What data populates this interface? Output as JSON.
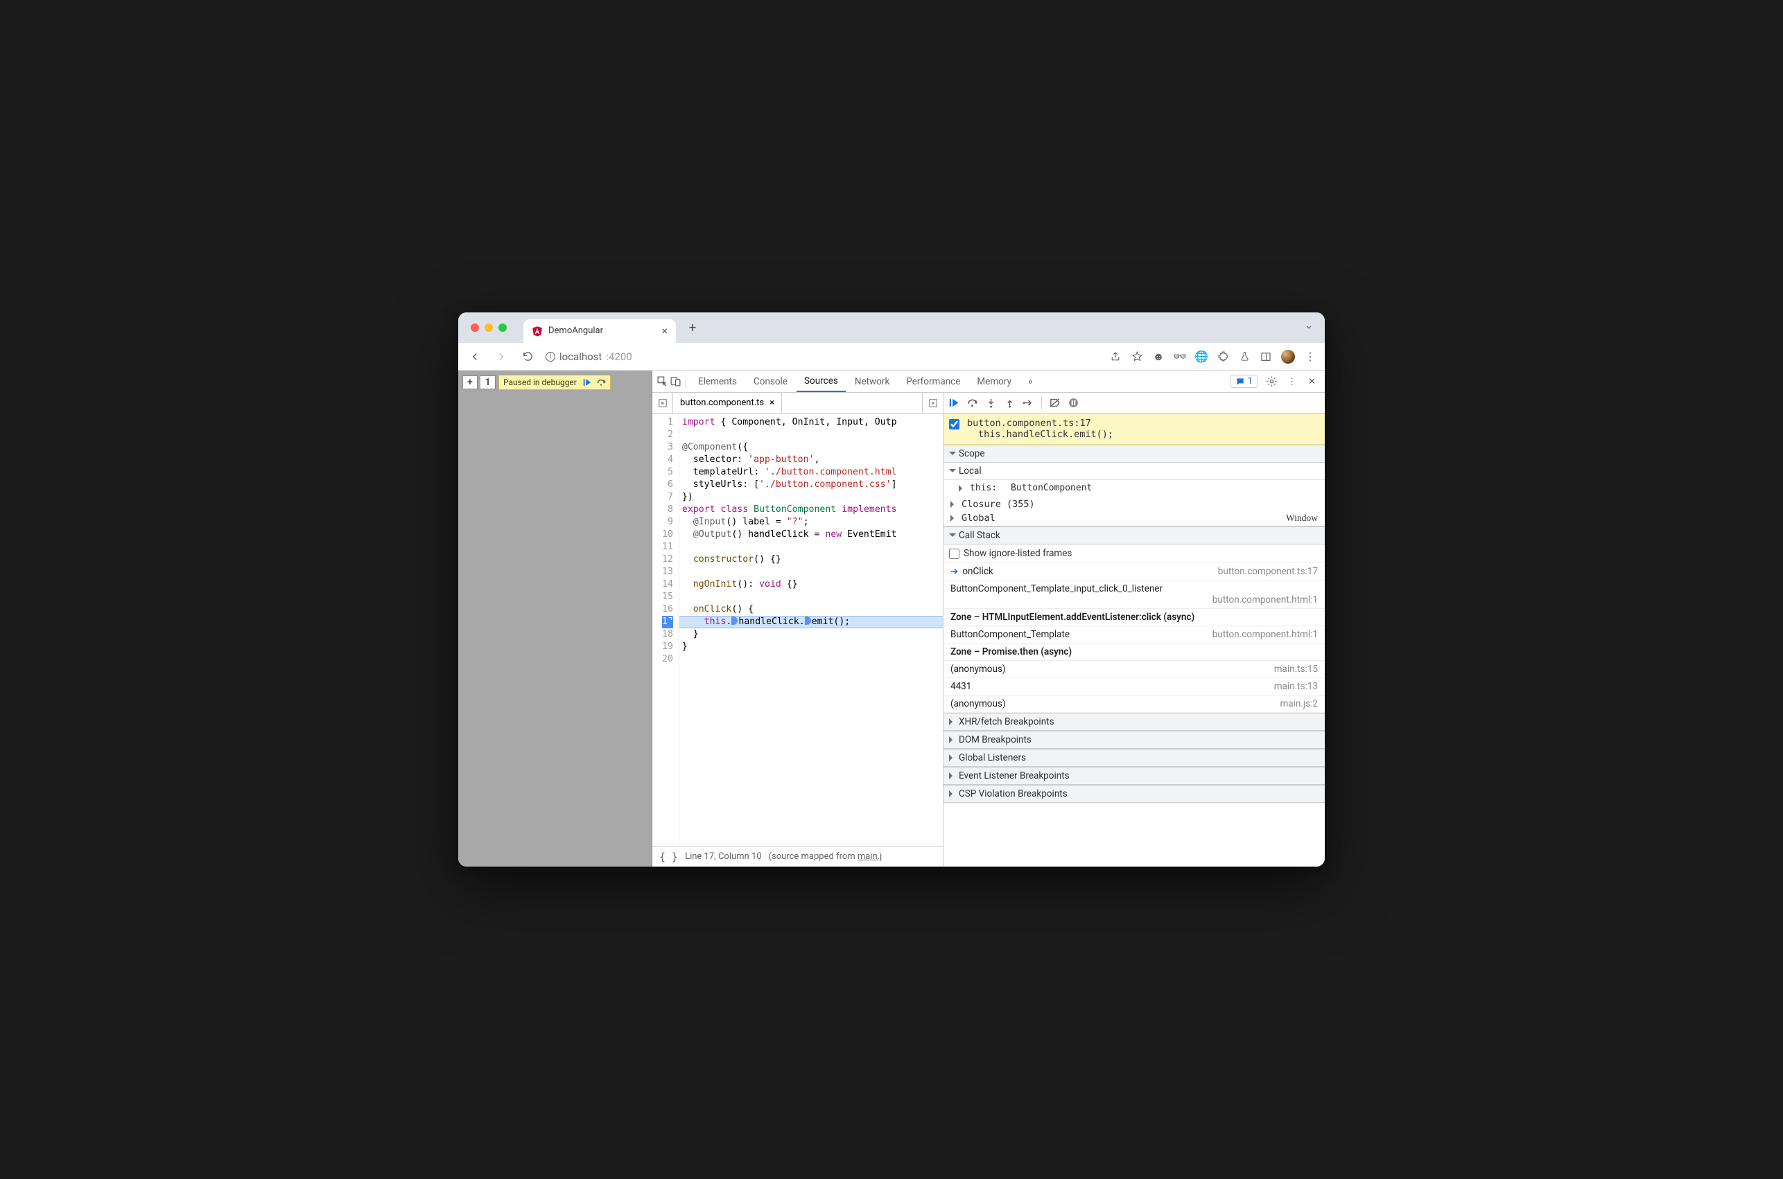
{
  "browser_tab": {
    "title": "DemoAngular"
  },
  "url": {
    "host": "localhost",
    "port": ":4200"
  },
  "paused_msg": "Paused in debugger",
  "devtools_panels": [
    "Elements",
    "Console",
    "Sources",
    "Network",
    "Performance",
    "Memory"
  ],
  "devtools_active_panel": "Sources",
  "issues_count": "1",
  "editor": {
    "file": "button.component.ts",
    "status_line": "Line 17, Column 10",
    "status_mapped_prefix": "(source mapped from ",
    "status_mapped_file": "main.j",
    "lines": [
      {
        "n": 1,
        "html": "<span class='tk-kw'>import</span> { Component, OnInit, Input, Outp"
      },
      {
        "n": 2,
        "html": ""
      },
      {
        "n": 3,
        "html": "<span class='tk-deco'>@Component</span>({"
      },
      {
        "n": 4,
        "html": "  selector: <span class='tk-str'>'app-button'</span>,"
      },
      {
        "n": 5,
        "html": "  templateUrl: <span class='tk-str'>'./button.component.html</span>"
      },
      {
        "n": 6,
        "html": "  styleUrls: [<span class='tk-str'>'./button.component.css'</span>]"
      },
      {
        "n": 7,
        "html": "})"
      },
      {
        "n": 8,
        "html": "<span class='tk-kw'>export</span> <span class='tk-kw'>class</span> <span class='tk-cls'>ButtonComponent</span> <span class='tk-kw'>implements</span>"
      },
      {
        "n": 9,
        "html": "  <span class='tk-deco'>@Input</span>() label = <span class='tk-str'>\"?\"</span>;"
      },
      {
        "n": 10,
        "html": "  <span class='tk-deco'>@Output</span>() handleClick = <span class='tk-kw'>new</span> EventEmit"
      },
      {
        "n": 11,
        "html": ""
      },
      {
        "n": 12,
        "html": "  <span class='tk-fn'>constructor</span>() {}"
      },
      {
        "n": 13,
        "html": ""
      },
      {
        "n": 14,
        "html": "  <span class='tk-fn'>ngOnInit</span>(): <span class='tk-kw'>void</span> {}"
      },
      {
        "n": 15,
        "html": ""
      },
      {
        "n": 16,
        "html": "  <span class='tk-fn'>onClick</span>() {"
      },
      {
        "n": 17,
        "html": "    <span class='tk-kw'>this</span>.<span class='mini-bp'></span>handleClick.<span class='mini-bp'></span>emit();",
        "exec": true,
        "bp": true
      },
      {
        "n": 18,
        "html": "  }"
      },
      {
        "n": 19,
        "html": "}"
      },
      {
        "n": 20,
        "html": ""
      }
    ]
  },
  "breakpoint_banner": {
    "file_loc": "button.component.ts:17",
    "stmt": "this.handleClick.emit();"
  },
  "scope": {
    "header": "Scope",
    "local": "Local",
    "this_label": "this:",
    "this_val": "ButtonComponent",
    "closure": "Closure (355)",
    "global": "Global",
    "global_val": "Window"
  },
  "callstack": {
    "header": "Call Stack",
    "show_ignored": "Show ignore-listed frames",
    "frames": [
      {
        "name": "onClick",
        "loc": "button.component.ts:17",
        "active": true
      },
      {
        "name": "ButtonComponent_Template_input_click_0_listener",
        "loc": "button.component.html:1",
        "twoLine": true
      },
      {
        "name": "Zone – HTMLInputElement.addEventListener:click (async)",
        "zone": true
      },
      {
        "name": "ButtonComponent_Template",
        "loc": "button.component.html:1"
      },
      {
        "name": "Zone – Promise.then (async)",
        "zone": true
      },
      {
        "name": "(anonymous)",
        "loc": "main.ts:15"
      },
      {
        "name": "4431",
        "loc": "main.ts:13"
      },
      {
        "name": "(anonymous)",
        "loc": "main.js:2"
      }
    ]
  },
  "bp_sections": [
    "XHR/fetch Breakpoints",
    "DOM Breakpoints",
    "Global Listeners",
    "Event Listener Breakpoints",
    "CSP Violation Breakpoints"
  ]
}
